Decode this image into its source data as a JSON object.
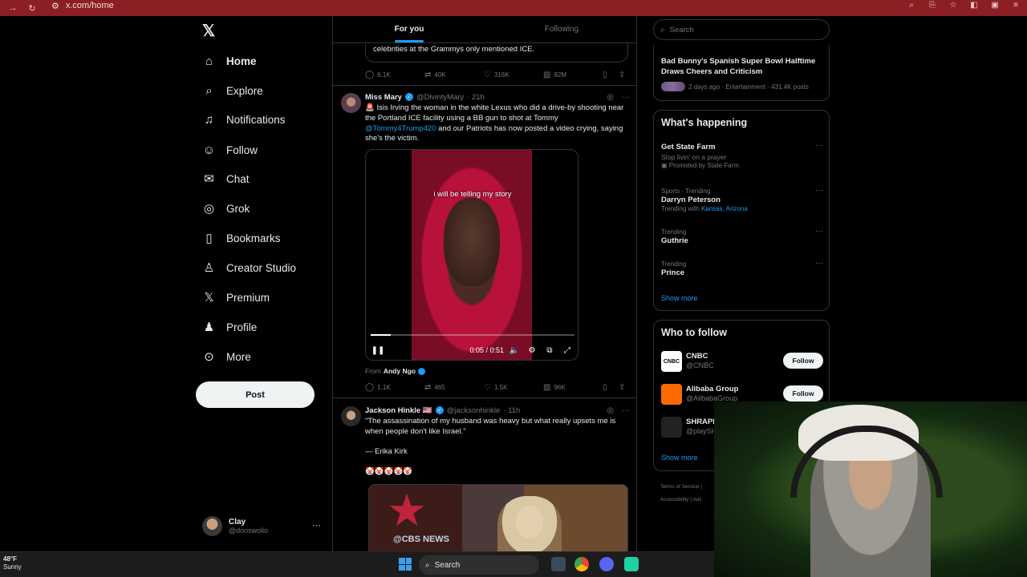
{
  "browser": {
    "url": "x.com/home",
    "nav_icons": [
      "arrow-right-icon",
      "reload-icon"
    ],
    "toolbar_icons": [
      "zoom-icon",
      "share-icon",
      "star-icon",
      "extension-icon",
      "sidebar-icon",
      "menu-icon"
    ]
  },
  "sidebar": {
    "logo": "𝕏",
    "items": [
      {
        "label": "Home",
        "icon": "⌂",
        "active": true
      },
      {
        "label": "Explore",
        "icon": "⌕"
      },
      {
        "label": "Notifications",
        "icon": "🔔"
      },
      {
        "label": "Follow",
        "icon": "👤"
      },
      {
        "label": "Chat",
        "icon": "✉"
      },
      {
        "label": "Grok",
        "icon": "◎"
      },
      {
        "label": "Bookmarks",
        "icon": "🔖"
      },
      {
        "label": "Creator Studio",
        "icon": "♙"
      },
      {
        "label": "Premium",
        "icon": "𝕏"
      },
      {
        "label": "Profile",
        "icon": "👤"
      },
      {
        "label": "More",
        "icon": "⋯"
      }
    ],
    "post_label": "Post",
    "account": {
      "name": "Clay",
      "handle": "@donswolio",
      "more": "···"
    }
  },
  "timeline": {
    "tabs": [
      {
        "label": "For you",
        "active": true
      },
      {
        "label": "Following"
      }
    ],
    "prev_tweet": {
      "quote_text": "celebrities at the Grammys only mentioned ICE.",
      "replies": "6.1K",
      "reposts": "40K",
      "likes": "316K",
      "views": "82M"
    },
    "tweet1": {
      "name": "Miss Mary",
      "handle": "@DivintyMary",
      "time": "· 21h",
      "text_a": "🚨 Isis Irving the woman in the white Lexus who did a drive-by shooting near the Portland ICE facility using a BB gun to shot at Tommy ",
      "mention": "@Tommy4Trump420",
      "text_b": " and our Patriots has now posted a video crying, saying she's the victim.",
      "video_caption": "i will be telling my story",
      "video_time": "0:05 / 0:51",
      "video_progress": 0.1,
      "from_label": "From",
      "from_name": "Andy Ngo",
      "replies": "1.1K",
      "reposts": "465",
      "likes": "1.5K",
      "views": "96K"
    },
    "tweet2": {
      "name": "Jackson Hinkle 🇺🇸",
      "handle": "@jacksonhinkle",
      "time": "· 11h",
      "text": "\"The assassination of my husband was heavy but what really upsets me is when people don't like Israel.\"",
      "attribution": "— Erika Kirk",
      "emojis": "🤡🤡🤡🤡🤡",
      "image_text": "@CBS NEWS"
    }
  },
  "right": {
    "search_placeholder": "Search",
    "news": {
      "title": "Bad Bunny's Spanish Super Bowl Halftime Draws Cheers and Criticism",
      "meta": "2 days ago · Entertainment · 431.4K posts"
    },
    "happening": {
      "title": "What's happening",
      "trends": [
        {
          "category": "",
          "title": "Get State Farm",
          "sub": "Stop livin' on a prayer",
          "promo": "Promoted by State Farm"
        },
        {
          "category": "Sports · Trending",
          "title": "Darryn Peterson",
          "sub_prefix": "Trending with ",
          "sub_links": "Kansas, Arizona"
        },
        {
          "category": "Trending",
          "title": "Guthrie"
        },
        {
          "category": "Trending",
          "title": "Prince"
        }
      ],
      "show_more": "Show more"
    },
    "who_to_follow": {
      "title": "Who to follow",
      "accounts": [
        {
          "name": "CNBC",
          "handle": "@CNBC",
          "button": "Follow",
          "color": "#ffffff"
        },
        {
          "name": "Alibaba Group",
          "handle": "@AlibabaGroup",
          "button": "Follow",
          "color": "#ff6a00"
        },
        {
          "name": "SHRAPN",
          "handle": "@playSH",
          "color": "#222222"
        }
      ],
      "show_more": "Show more"
    },
    "footer": [
      "Terms of Service",
      "|",
      "Accessibility",
      "|",
      "Ads"
    ]
  },
  "taskbar": {
    "temp": "48°F",
    "weather": "Sunny",
    "search": "Search"
  }
}
